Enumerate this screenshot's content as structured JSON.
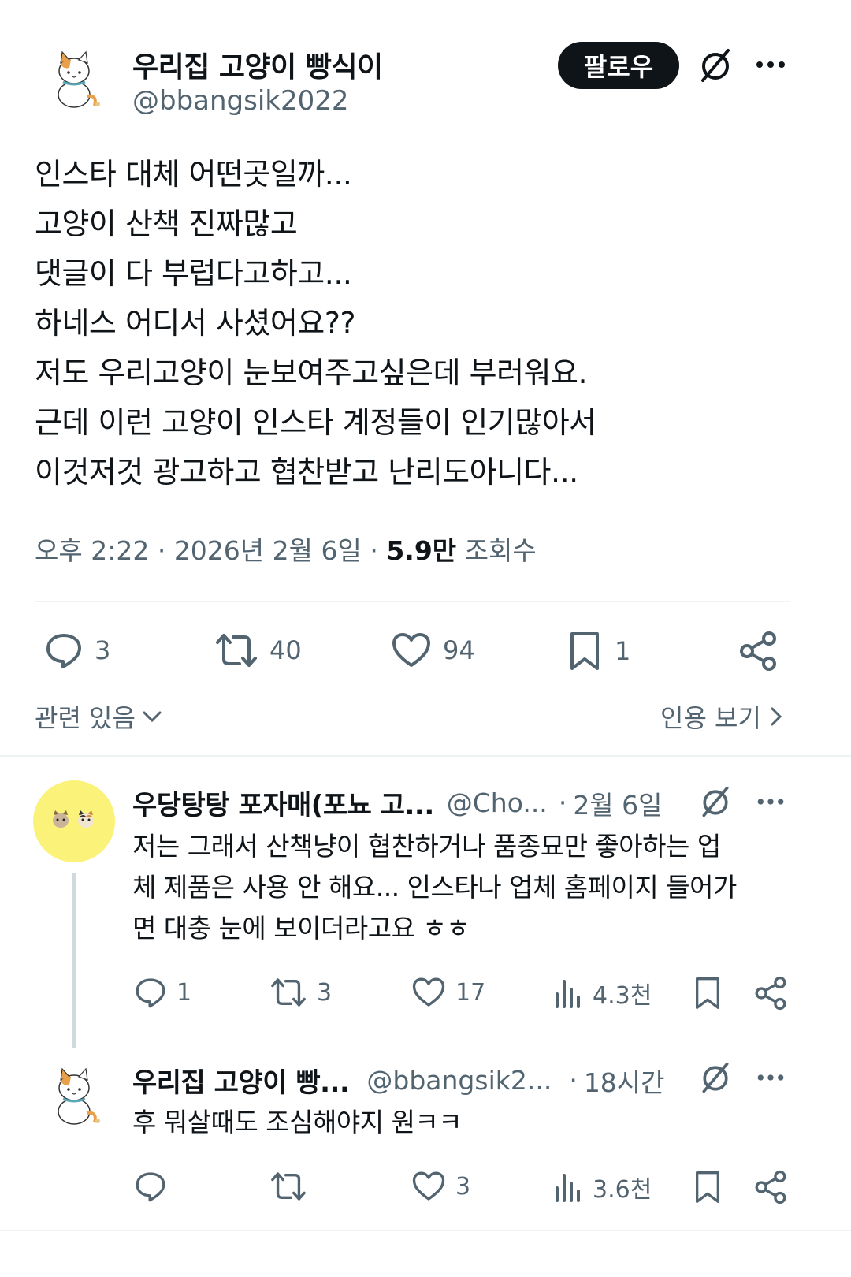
{
  "main_tweet": {
    "display_name": "우리집 고양이 빵식이",
    "handle": "@bbangsik2022",
    "follow_label": "팔로우",
    "body_lines": [
      "인스타 대체 어떤곳일까...",
      "고양이 산책 진짜많고",
      "댓글이 다 부럽다고하고...",
      "하네스 어디서 사셨어요??",
      "저도 우리고양이 눈보여주고싶은데 부러워요.",
      "근데 이런 고양이 인스타 계정들이 인기많아서",
      "이것저것 광고하고 협찬받고 난리도아니다..."
    ],
    "time": "오후 2:22",
    "date": "2026년 2월 6일",
    "views_count": "5.9만",
    "views_label": "조회수",
    "stats": {
      "replies": "3",
      "reposts": "40",
      "likes": "94",
      "bookmarks": "1"
    },
    "related_label": "관련 있음",
    "quotes_label": "인용 보기"
  },
  "replies": [
    {
      "display_name": "우당탕탕 포자매(포뇨 고...",
      "handle": "@Cho...",
      "time": "2월 6일",
      "text_lines": [
        "저는 그래서 산책냥이 협찬하거나 품종묘만 좋아하는 업",
        "체 제품은 사용 안 해요... 인스타나 업체 홈페이지 들어가",
        "면 대충 눈에 보이더라고요 ㅎㅎ"
      ],
      "stats": {
        "replies": "1",
        "reposts": "3",
        "likes": "17",
        "views": "4.3천"
      }
    },
    {
      "display_name": "우리집 고양이 빵...",
      "handle": "@bbangsik2...",
      "time": "18시간",
      "text_lines": [
        "후 뭐살때도 조심해야지 원ㅋㅋ"
      ],
      "stats": {
        "replies": "",
        "reposts": "",
        "likes": "3",
        "views": "3.6천"
      }
    }
  ],
  "colors": {
    "text": "#0f1419",
    "muted": "#536471",
    "divider": "#eff3f4",
    "yellow_avatar": "#fbf27a",
    "thread_line": "#cfd9de"
  }
}
